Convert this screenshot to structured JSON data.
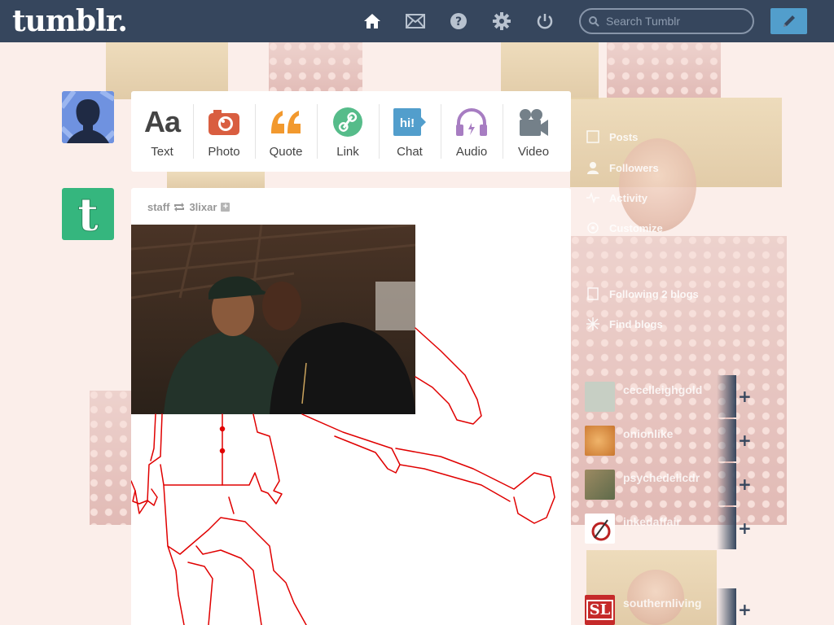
{
  "header": {
    "logo": "tumblr.",
    "nav": [
      {
        "name": "home-icon",
        "label": "Dashboard"
      },
      {
        "name": "mail-icon",
        "label": "Messages"
      },
      {
        "name": "help-icon",
        "label": "Help"
      },
      {
        "name": "gear-icon",
        "label": "Settings"
      },
      {
        "name": "power-icon",
        "label": "Log out"
      }
    ],
    "search_placeholder": "Search Tumblr",
    "compose_icon": "pencil-icon"
  },
  "post_types": [
    {
      "label": "Text",
      "icon": "text-icon",
      "color": "#444444"
    },
    {
      "label": "Photo",
      "icon": "camera-icon",
      "color": "#d95e40"
    },
    {
      "label": "Quote",
      "icon": "quote-icon",
      "color": "#f2992e"
    },
    {
      "label": "Link",
      "icon": "link-icon",
      "color": "#56bc8a"
    },
    {
      "label": "Chat",
      "icon": "chat-icon",
      "color": "#529ecc"
    },
    {
      "label": "Audio",
      "icon": "headphones-icon",
      "color": "#a77dc2"
    },
    {
      "label": "Video",
      "icon": "video-camera-icon",
      "color": "#748089"
    }
  ],
  "post": {
    "author": "staff",
    "reblogged_from": "3lixar",
    "follow_label": "+"
  },
  "sidebar": {
    "links": [
      {
        "label": "Posts",
        "icon": "posts-icon"
      },
      {
        "label": "Followers",
        "icon": "followers-icon"
      },
      {
        "label": "Activity",
        "icon": "activity-icon"
      },
      {
        "label": "Customize",
        "icon": "customize-icon"
      },
      {
        "label": "Following 2 blogs",
        "icon": "following-icon"
      },
      {
        "label": "Find blogs",
        "icon": "find-blogs-icon"
      }
    ],
    "recommended": [
      {
        "name": "cecelleighgold",
        "avatar_color": "#c7cfc4"
      },
      {
        "name": "onionlike",
        "avatar_color": "#e39b4a"
      },
      {
        "name": "psychedelicdr",
        "avatar_color": "#8a7a5a"
      },
      {
        "name": "inkedaffair",
        "avatar_color": "#ffffff"
      },
      {
        "name": "southernliving",
        "avatar_color": "#c52a2a",
        "avatar_text": "SL"
      }
    ]
  },
  "colors": {
    "header_bg": "#36465d",
    "accent": "#529ecc",
    "staff_avatar": "#35b67e",
    "drawing_stroke": "#e00000"
  }
}
